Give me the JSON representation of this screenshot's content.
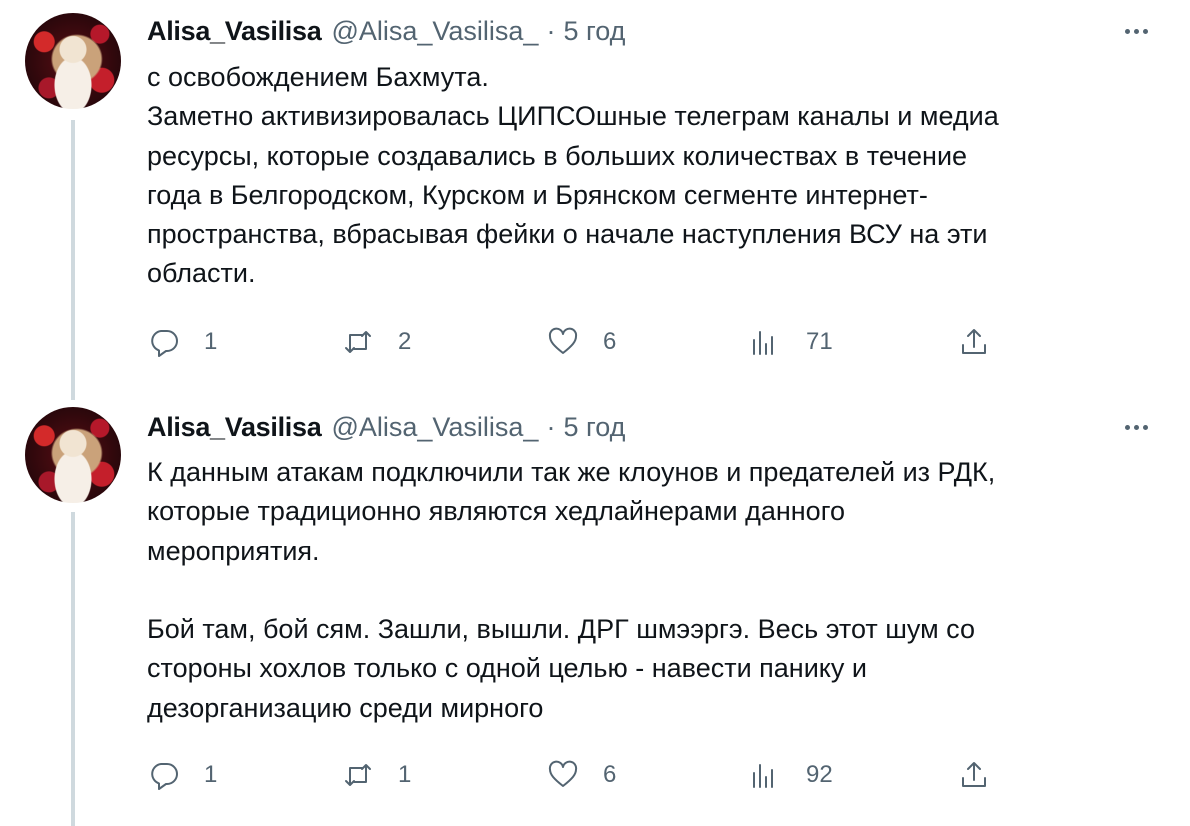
{
  "tweets": [
    {
      "author_name": "Alisa_Vasilisa",
      "handle": "@Alisa_Vasilisa_",
      "separator": "·",
      "time": "5 год",
      "lines": [
        "с освобождением Бахмута.",
        "Заметно активизировалась ЦИПСОшные телеграм каналы и медиа",
        "ресурсы, которые создавались в больших количествах в течение",
        "года в Белгородском, Курском и Брянском сегменте интернет-",
        "пространства, вбрасывая фейки о начале наступления ВСУ на эти",
        "области."
      ],
      "replies": "1",
      "retweets": "2",
      "likes": "6",
      "views": "71"
    },
    {
      "author_name": "Alisa_Vasilisa",
      "handle": "@Alisa_Vasilisa_",
      "separator": "·",
      "time": "5 год",
      "lines": [
        "К данным атакам подключили так же клоунов и предателей из РДК,",
        "которые традиционно являются хедлайнерами данного",
        "мероприятия.",
        "",
        "Бой там, бой сям. Зашли, вышли. ДРГ шмээргэ. Весь этот шум со",
        "стороны хохлов только с одной целью - навести панику и",
        "дезорганизацию среди мирного"
      ],
      "replies": "1",
      "retweets": "1",
      "likes": "6",
      "views": "92"
    }
  ],
  "icons": {
    "more": "more-horizontal-icon",
    "reply": "reply-bubble-icon",
    "retweet": "retweet-icon",
    "like": "heart-icon",
    "views": "bar-chart-views-icon",
    "share": "share-upload-icon"
  },
  "colors": {
    "text": "#0f1419",
    "secondary": "#536471",
    "thread_line": "#cfd9de"
  }
}
